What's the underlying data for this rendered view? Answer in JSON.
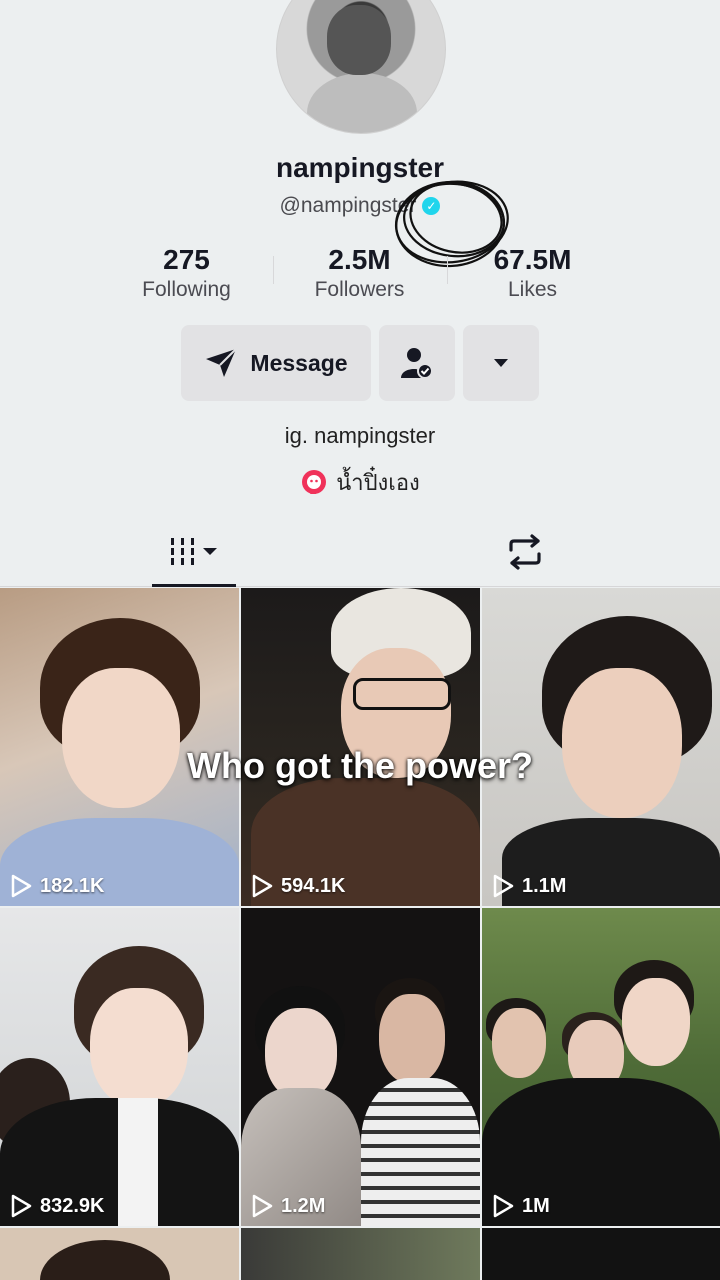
{
  "profile": {
    "display_name": "nampingster",
    "username": "@nampingster",
    "verified": true
  },
  "stats": [
    {
      "value": "275",
      "label": "Following"
    },
    {
      "value": "2.5M",
      "label": "Followers"
    },
    {
      "value": "67.5M",
      "label": "Likes"
    }
  ],
  "actions": {
    "message_label": "Message"
  },
  "bio": {
    "line1": "ig. nampingster",
    "line2": "น้ำปิ๋งเอง"
  },
  "videos": [
    {
      "views": "182.1K"
    },
    {
      "views": "594.1K"
    },
    {
      "views": "1.1M"
    },
    {
      "views": "832.9K"
    },
    {
      "views": "1.2M"
    },
    {
      "views": "1M"
    }
  ],
  "overlay_caption": "Who got the power?",
  "colors": {
    "background": "#eceff0",
    "button": "#e2e2e4",
    "verified": "#20d5ec",
    "text": "#161823"
  }
}
